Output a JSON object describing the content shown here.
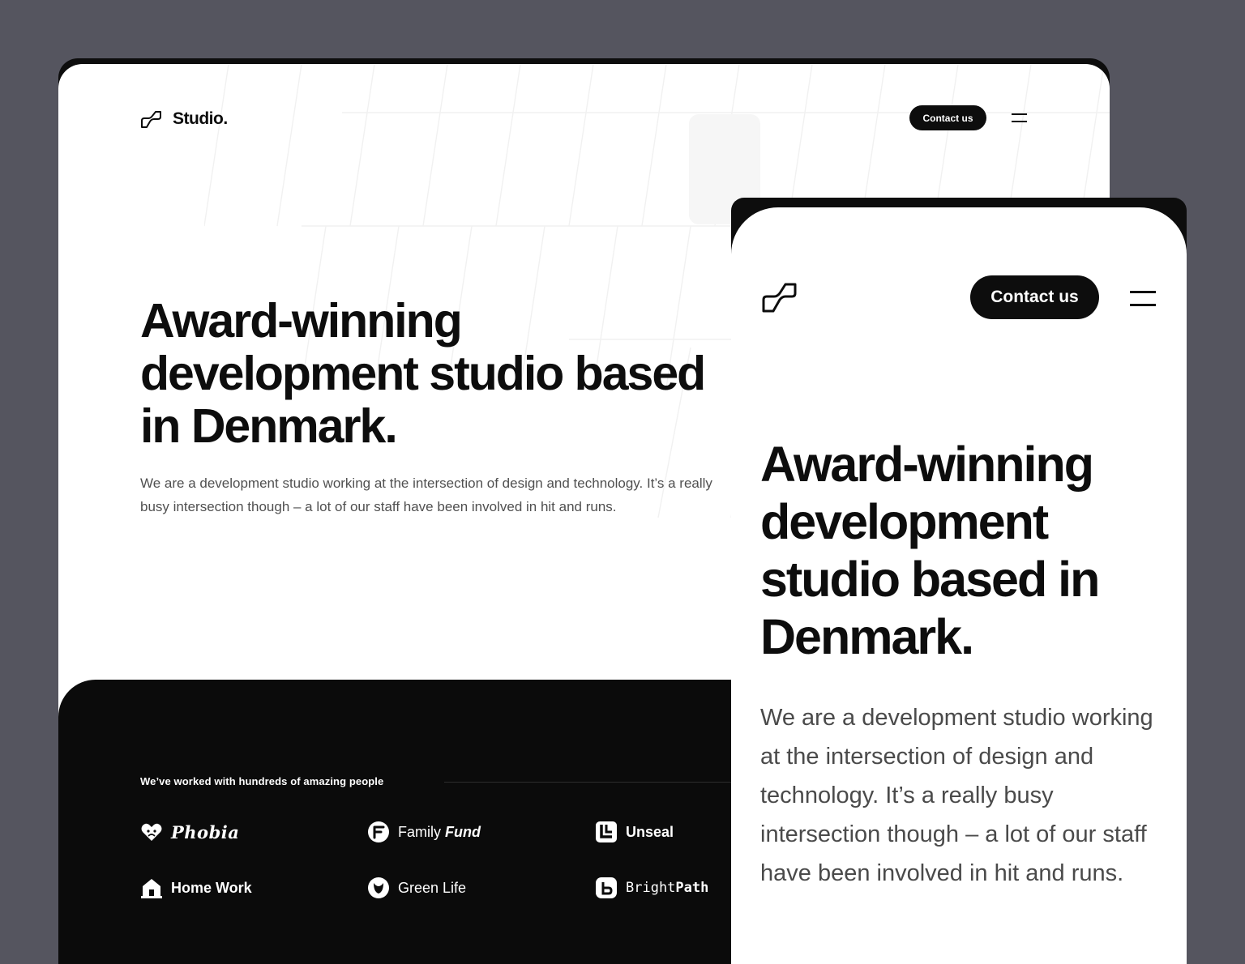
{
  "desktop": {
    "nav": {
      "logo_icon": "studio-wave-logo-icon",
      "logo_text": "Studio.",
      "contact_label": "Contact us",
      "menu_icon": "hamburger-menu-icon"
    },
    "hero": {
      "headline": "Award-winning development studio based in Denmark.",
      "body": "We are a development studio working at the intersection of design and technology. It’s a really busy intersection though – a lot of our staff have been involved in hit and runs."
    },
    "clients": {
      "label": "We’ve worked with hundreds of amazing people",
      "items": [
        {
          "name": "Phobia",
          "icon": "heart-face-icon"
        },
        {
          "name_prefix": "Family",
          "name_suffix": "Fund",
          "icon": "f-circle-icon"
        },
        {
          "name": "Unseal",
          "icon": "unseal-square-icon"
        },
        {
          "name": "Home Work",
          "icon": "house-icon"
        },
        {
          "name": "Green Life",
          "icon": "leaf-circle-icon"
        },
        {
          "name_prefix": "Bright",
          "name_suffix": "Path",
          "icon": "bp-square-icon"
        }
      ]
    }
  },
  "mobile": {
    "nav": {
      "logo_icon": "studio-wave-logo-icon",
      "contact_label": "Contact us",
      "menu_icon": "hamburger-menu-icon"
    },
    "hero": {
      "headline": "Award-winning development studio based in Denmark.",
      "body": "We are a development studio working at the intersection of design and technology. It’s a really busy intersection though – a lot of our staff have been involved in hit and runs."
    }
  },
  "colors": {
    "canvas": "#55555f",
    "ink": "#0d0d0d",
    "dark_band": "#0b0b0b",
    "body_text": "#505050",
    "white": "#ffffff"
  }
}
